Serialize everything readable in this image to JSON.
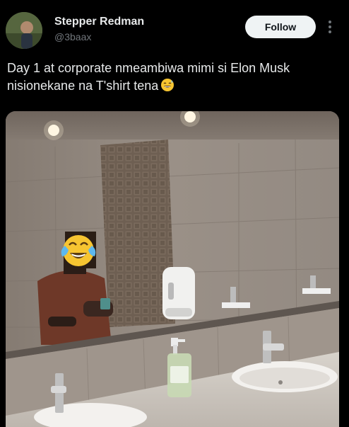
{
  "author": {
    "display_name": "Stepper Redman",
    "handle": "@3baax"
  },
  "actions": {
    "follow_label": "Follow",
    "more_icon": "more-vertical-icon"
  },
  "tweet": {
    "text": "Day 1 at corporate nmeambiwa mimi si Elon Musk nisionekane na T'shirt tena",
    "emoji": "grinning-sweat-emoji"
  },
  "media": {
    "description_icon": "bathroom-mirror-selfie-photo",
    "face_cover_emoji": "tears-of-joy-emoji"
  },
  "colors": {
    "background": "#000000",
    "primary_text": "#e7e9ea",
    "secondary_text": "#71767b",
    "follow_button_bg": "#eff3f4",
    "follow_button_text": "#0f1419"
  }
}
